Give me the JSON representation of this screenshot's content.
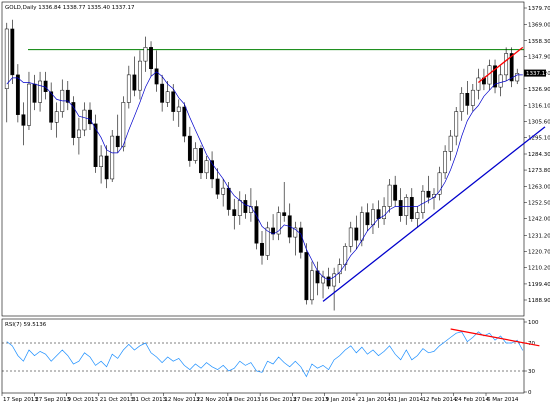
{
  "chart_data": [
    {
      "type": "candlestick",
      "symbol": "GOLD",
      "timeframe": "Daily",
      "header": "GOLD,Daily  1336.84 1338.77 1335.40 1337.17",
      "ohlc_last": {
        "open": 1336.84,
        "high": 1338.77,
        "low": 1335.4,
        "close": 1337.17
      },
      "price_tag": "1337.17",
      "y_ticks": [
        "1379.70",
        "1369.00",
        "1358.30",
        "1347.90",
        "1337.20",
        "1326.90",
        "1316.10",
        "1305.60",
        "1295.10",
        "1284.30",
        "1273.80",
        "1263.00",
        "1252.50",
        "1242.00",
        "1231.20",
        "1220.70",
        "1210.20",
        "1199.40",
        "1188.90"
      ],
      "ylim": [
        1188.9,
        1379.7
      ],
      "x_ticks": [
        "17 Sep 2013",
        "27 Sep 2013",
        "9 Oct 2013",
        "21 Oct 2013",
        "31 Oct 2013",
        "12 Nov 2013",
        "22 Nov 2013",
        "4 Dec 2013",
        "16 Dec 2013",
        "27 Dec 2013",
        "9 Jan 2014",
        "21 Jan 2014",
        "31 Jan 2014",
        "12 Feb 2014",
        "24 Feb 2014",
        "6 Mar 2014"
      ],
      "candles": [
        {
          "o": 1327,
          "h": 1370,
          "l": 1305,
          "c": 1366
        },
        {
          "o": 1366,
          "h": 1372,
          "l": 1330,
          "c": 1336
        },
        {
          "o": 1336,
          "h": 1343,
          "l": 1305,
          "c": 1310
        },
        {
          "o": 1310,
          "h": 1318,
          "l": 1290,
          "c": 1303
        },
        {
          "o": 1303,
          "h": 1338,
          "l": 1300,
          "c": 1330
        },
        {
          "o": 1330,
          "h": 1336,
          "l": 1313,
          "c": 1318
        },
        {
          "o": 1318,
          "h": 1338,
          "l": 1312,
          "c": 1332
        },
        {
          "o": 1332,
          "h": 1338,
          "l": 1320,
          "c": 1325
        },
        {
          "o": 1325,
          "h": 1331,
          "l": 1300,
          "c": 1305
        },
        {
          "o": 1305,
          "h": 1318,
          "l": 1295,
          "c": 1312
        },
        {
          "o": 1312,
          "h": 1333,
          "l": 1308,
          "c": 1326
        },
        {
          "o": 1326,
          "h": 1332,
          "l": 1313,
          "c": 1318
        },
        {
          "o": 1318,
          "h": 1322,
          "l": 1290,
          "c": 1295
        },
        {
          "o": 1295,
          "h": 1308,
          "l": 1284,
          "c": 1300
        },
        {
          "o": 1300,
          "h": 1318,
          "l": 1296,
          "c": 1313
        },
        {
          "o": 1313,
          "h": 1318,
          "l": 1300,
          "c": 1304
        },
        {
          "o": 1304,
          "h": 1310,
          "l": 1272,
          "c": 1276
        },
        {
          "o": 1276,
          "h": 1290,
          "l": 1265,
          "c": 1283
        },
        {
          "o": 1283,
          "h": 1290,
          "l": 1262,
          "c": 1268
        },
        {
          "o": 1268,
          "h": 1300,
          "l": 1266,
          "c": 1296
        },
        {
          "o": 1296,
          "h": 1310,
          "l": 1285,
          "c": 1289
        },
        {
          "o": 1289,
          "h": 1322,
          "l": 1286,
          "c": 1318
        },
        {
          "o": 1318,
          "h": 1342,
          "l": 1314,
          "c": 1336
        },
        {
          "o": 1336,
          "h": 1348,
          "l": 1322,
          "c": 1326
        },
        {
          "o": 1326,
          "h": 1352,
          "l": 1320,
          "c": 1345
        },
        {
          "o": 1345,
          "h": 1361,
          "l": 1338,
          "c": 1354
        },
        {
          "o": 1354,
          "h": 1358,
          "l": 1335,
          "c": 1340
        },
        {
          "o": 1340,
          "h": 1352,
          "l": 1325,
          "c": 1330
        },
        {
          "o": 1330,
          "h": 1336,
          "l": 1312,
          "c": 1318
        },
        {
          "o": 1318,
          "h": 1332,
          "l": 1315,
          "c": 1325
        },
        {
          "o": 1325,
          "h": 1330,
          "l": 1306,
          "c": 1312
        },
        {
          "o": 1312,
          "h": 1320,
          "l": 1302,
          "c": 1315
        },
        {
          "o": 1315,
          "h": 1318,
          "l": 1292,
          "c": 1296
        },
        {
          "o": 1296,
          "h": 1302,
          "l": 1276,
          "c": 1280
        },
        {
          "o": 1280,
          "h": 1292,
          "l": 1278,
          "c": 1288
        },
        {
          "o": 1288,
          "h": 1290,
          "l": 1268,
          "c": 1272
        },
        {
          "o": 1272,
          "h": 1283,
          "l": 1268,
          "c": 1280
        },
        {
          "o": 1280,
          "h": 1286,
          "l": 1262,
          "c": 1268
        },
        {
          "o": 1268,
          "h": 1275,
          "l": 1255,
          "c": 1258
        },
        {
          "o": 1258,
          "h": 1268,
          "l": 1250,
          "c": 1262
        },
        {
          "o": 1262,
          "h": 1266,
          "l": 1244,
          "c": 1248
        },
        {
          "o": 1248,
          "h": 1255,
          "l": 1235,
          "c": 1244
        },
        {
          "o": 1244,
          "h": 1260,
          "l": 1238,
          "c": 1254
        },
        {
          "o": 1254,
          "h": 1258,
          "l": 1242,
          "c": 1246
        },
        {
          "o": 1246,
          "h": 1262,
          "l": 1240,
          "c": 1250
        },
        {
          "o": 1250,
          "h": 1254,
          "l": 1222,
          "c": 1226
        },
        {
          "o": 1226,
          "h": 1234,
          "l": 1212,
          "c": 1218
        },
        {
          "o": 1218,
          "h": 1240,
          "l": 1215,
          "c": 1236
        },
        {
          "o": 1236,
          "h": 1245,
          "l": 1228,
          "c": 1232
        },
        {
          "o": 1232,
          "h": 1250,
          "l": 1228,
          "c": 1246
        },
        {
          "o": 1246,
          "h": 1266,
          "l": 1240,
          "c": 1244
        },
        {
          "o": 1244,
          "h": 1252,
          "l": 1226,
          "c": 1230
        },
        {
          "o": 1230,
          "h": 1240,
          "l": 1218,
          "c": 1236
        },
        {
          "o": 1236,
          "h": 1240,
          "l": 1216,
          "c": 1220
        },
        {
          "o": 1220,
          "h": 1226,
          "l": 1186,
          "c": 1189
        },
        {
          "o": 1189,
          "h": 1214,
          "l": 1186,
          "c": 1208
        },
        {
          "o": 1208,
          "h": 1214,
          "l": 1192,
          "c": 1200
        },
        {
          "o": 1200,
          "h": 1208,
          "l": 1190,
          "c": 1204
        },
        {
          "o": 1204,
          "h": 1210,
          "l": 1196,
          "c": 1198
        },
        {
          "o": 1198,
          "h": 1210,
          "l": 1182,
          "c": 1206
        },
        {
          "o": 1206,
          "h": 1216,
          "l": 1200,
          "c": 1212
        },
        {
          "o": 1212,
          "h": 1226,
          "l": 1208,
          "c": 1224
        },
        {
          "o": 1224,
          "h": 1240,
          "l": 1220,
          "c": 1236
        },
        {
          "o": 1236,
          "h": 1244,
          "l": 1222,
          "c": 1228
        },
        {
          "o": 1228,
          "h": 1250,
          "l": 1224,
          "c": 1246
        },
        {
          "o": 1246,
          "h": 1252,
          "l": 1234,
          "c": 1238
        },
        {
          "o": 1238,
          "h": 1252,
          "l": 1232,
          "c": 1248
        },
        {
          "o": 1248,
          "h": 1254,
          "l": 1236,
          "c": 1242
        },
        {
          "o": 1242,
          "h": 1256,
          "l": 1238,
          "c": 1250
        },
        {
          "o": 1250,
          "h": 1268,
          "l": 1246,
          "c": 1264
        },
        {
          "o": 1264,
          "h": 1270,
          "l": 1250,
          "c": 1254
        },
        {
          "o": 1254,
          "h": 1262,
          "l": 1240,
          "c": 1244
        },
        {
          "o": 1244,
          "h": 1258,
          "l": 1238,
          "c": 1256
        },
        {
          "o": 1256,
          "h": 1262,
          "l": 1240,
          "c": 1242
        },
        {
          "o": 1242,
          "h": 1250,
          "l": 1236,
          "c": 1246
        },
        {
          "o": 1246,
          "h": 1264,
          "l": 1242,
          "c": 1260
        },
        {
          "o": 1260,
          "h": 1270,
          "l": 1252,
          "c": 1256
        },
        {
          "o": 1256,
          "h": 1262,
          "l": 1248,
          "c": 1258
        },
        {
          "o": 1258,
          "h": 1276,
          "l": 1254,
          "c": 1272
        },
        {
          "o": 1272,
          "h": 1290,
          "l": 1268,
          "c": 1286
        },
        {
          "o": 1286,
          "h": 1300,
          "l": 1280,
          "c": 1296
        },
        {
          "o": 1296,
          "h": 1315,
          "l": 1290,
          "c": 1312
        },
        {
          "o": 1312,
          "h": 1328,
          "l": 1306,
          "c": 1324
        },
        {
          "o": 1324,
          "h": 1332,
          "l": 1310,
          "c": 1316
        },
        {
          "o": 1316,
          "h": 1330,
          "l": 1312,
          "c": 1326
        },
        {
          "o": 1326,
          "h": 1340,
          "l": 1320,
          "c": 1334
        },
        {
          "o": 1334,
          "h": 1340,
          "l": 1326,
          "c": 1330
        },
        {
          "o": 1330,
          "h": 1346,
          "l": 1326,
          "c": 1342
        },
        {
          "o": 1342,
          "h": 1346,
          "l": 1324,
          "c": 1328
        },
        {
          "o": 1328,
          "h": 1342,
          "l": 1322,
          "c": 1336
        },
        {
          "o": 1336,
          "h": 1354,
          "l": 1332,
          "c": 1350
        },
        {
          "o": 1350,
          "h": 1354,
          "l": 1328,
          "c": 1332
        },
        {
          "o": 1332,
          "h": 1340,
          "l": 1330,
          "c": 1337
        }
      ],
      "moving_average": [
        1330,
        1334,
        1334,
        1331,
        1331,
        1330,
        1329,
        1328,
        1324,
        1320,
        1319,
        1319,
        1315,
        1309,
        1308,
        1307,
        1301,
        1295,
        1287,
        1285,
        1285,
        1290,
        1300,
        1309,
        1318,
        1328,
        1335,
        1338,
        1335,
        1330,
        1327,
        1321,
        1317,
        1308,
        1300,
        1292,
        1284,
        1278,
        1273,
        1268,
        1262,
        1257,
        1254,
        1251,
        1250,
        1244,
        1237,
        1234,
        1232,
        1234,
        1238,
        1237,
        1235,
        1232,
        1222,
        1215,
        1208,
        1204,
        1202,
        1204,
        1207,
        1212,
        1218,
        1222,
        1228,
        1234,
        1238,
        1242,
        1244,
        1248,
        1250,
        1250,
        1250,
        1250,
        1250,
        1252,
        1254,
        1256,
        1260,
        1266,
        1274,
        1284,
        1296,
        1306,
        1312,
        1316,
        1322,
        1326,
        1330,
        1331,
        1332,
        1334,
        1336,
        1336
      ],
      "horizontal_level": 1352.5,
      "trendlines": [
        {
          "color": "#0000cc",
          "from": {
            "bar": 57,
            "price": 1188
          },
          "to": {
            "bar": 97,
            "price": 1302
          }
        },
        {
          "color": "#ff0000",
          "from": {
            "bar": 85,
            "price": 1331
          },
          "to": {
            "bar": 93,
            "price": 1354
          }
        }
      ],
      "colors": {
        "candle": "#000000",
        "moving_average": "#0000cc",
        "horizontal_level": "#008000",
        "support_line": "#0000cc",
        "resistance_line": "#ff0000"
      }
    },
    {
      "type": "line",
      "indicator": "RSI(7)",
      "header": "RSI(7) 59.5136",
      "ylim": [
        0,
        100
      ],
      "y_ticks": [
        "100",
        "70",
        "30",
        "0"
      ],
      "levels": [
        70,
        30
      ],
      "values": [
        72,
        66,
        52,
        44,
        60,
        52,
        58,
        54,
        44,
        52,
        60,
        52,
        40,
        44,
        56,
        50,
        38,
        44,
        36,
        54,
        48,
        60,
        68,
        60,
        66,
        70,
        56,
        50,
        42,
        50,
        44,
        48,
        38,
        32,
        40,
        34,
        42,
        36,
        32,
        38,
        30,
        34,
        44,
        38,
        42,
        30,
        28,
        44,
        40,
        50,
        42,
        36,
        44,
        36,
        22,
        40,
        34,
        38,
        32,
        46,
        52,
        60,
        66,
        56,
        64,
        54,
        60,
        52,
        58,
        66,
        54,
        46,
        60,
        46,
        52,
        62,
        56,
        58,
        66,
        72,
        78,
        84,
        86,
        72,
        78,
        86,
        80,
        84,
        74,
        80,
        70,
        70,
        74,
        59.5
      ],
      "trendline": {
        "color": "#ff0000",
        "from": {
          "bar": 80,
          "value": 90
        },
        "to": {
          "bar": 96,
          "value": 66
        }
      },
      "colors": {
        "line": "#1e90ff",
        "level": "#000000"
      }
    }
  ]
}
